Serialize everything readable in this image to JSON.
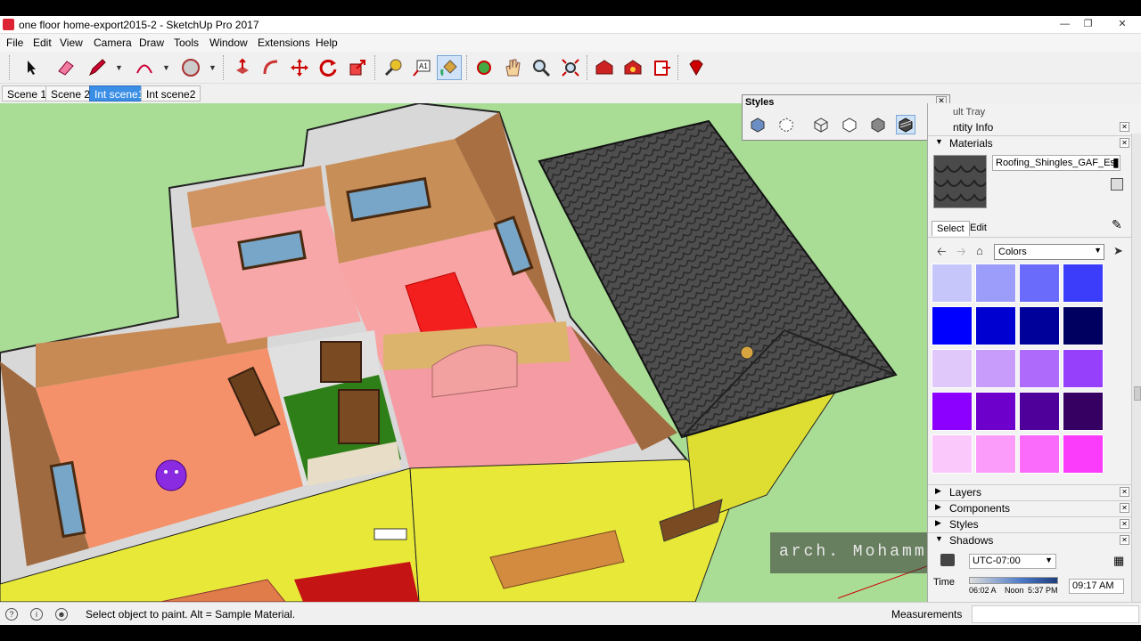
{
  "window": {
    "title": "one floor home-export2015-2 - SketchUp Pro 2017",
    "controls": [
      "minimize",
      "restore",
      "close"
    ]
  },
  "menu": [
    "File",
    "Edit",
    "View",
    "Camera",
    "Draw",
    "Tools",
    "Window",
    "Extensions",
    "Help"
  ],
  "toolbar": {
    "tools": [
      "select-icon",
      "eraser-icon",
      "pencil-icon",
      "arc-icon",
      "circle-icon",
      "push-pull-icon",
      "follow-me-icon",
      "move-icon",
      "rotate-icon",
      "scale-icon",
      "tape-measure-icon",
      "text-icon",
      "paint-bucket-icon",
      "orbit-icon",
      "pan-icon",
      "zoom-icon",
      "zoom-extents-icon",
      "warehouse-icon",
      "extension-warehouse-icon",
      "send-to-layout-icon",
      "ruby-icon"
    ],
    "active_tool": "paint-bucket-icon"
  },
  "scenes": [
    {
      "label": "Scene 1",
      "active": false
    },
    {
      "label": "Scene 2",
      "active": false
    },
    {
      "label": "Int scene1",
      "active": true
    },
    {
      "label": "Int scene2",
      "active": false
    }
  ],
  "styles_window": {
    "title": "Styles",
    "icons": [
      "xray-icon",
      "back-edges-icon",
      "wireframe-icon",
      "hidden-line-icon",
      "shaded-icon",
      "shaded-textures-icon",
      "monochrome-icon"
    ],
    "active_icon": "shaded-textures-icon"
  },
  "tray": {
    "header": "ult Tray",
    "entity_info": "ntity Info",
    "materials": {
      "label": "Materials",
      "name": "Roofing_Shingles_GAF_Est",
      "tabs": [
        "Select",
        "Edit"
      ],
      "collection": "Colors",
      "swatches": [
        [
          "#c6c6fa",
          "#9c9cfa",
          "#6b6bfb",
          "#3c3cfb"
        ],
        [
          "#0000ff",
          "#0000d0",
          "#00009a",
          "#000060"
        ],
        [
          "#e0c8fb",
          "#c79cfa",
          "#ae6bfb",
          "#9640fb"
        ],
        [
          "#8b00ff",
          "#6e00cc",
          "#50009a",
          "#350062"
        ],
        [
          "#fbc8fb",
          "#fb9cfb",
          "#fb6bfb",
          "#fb3cfb"
        ]
      ]
    },
    "panels": [
      "Layers",
      "Components",
      "Styles",
      "Shadows"
    ],
    "shadows": {
      "timezone": "UTC-07:00",
      "time_label": "Time",
      "time_start": "06:02 A",
      "time_noon": "Noon",
      "time_end": "5:37 PM",
      "time_value": "09:17 AM"
    }
  },
  "watermark": "arch. Mohammed Mansour",
  "status": {
    "message": "Select object to paint. Alt = Sample Material.",
    "measurements_label": "Measurements"
  },
  "colors": {
    "viewport_bg": "#a9dd96",
    "active_tab": "#3a8ee6"
  }
}
